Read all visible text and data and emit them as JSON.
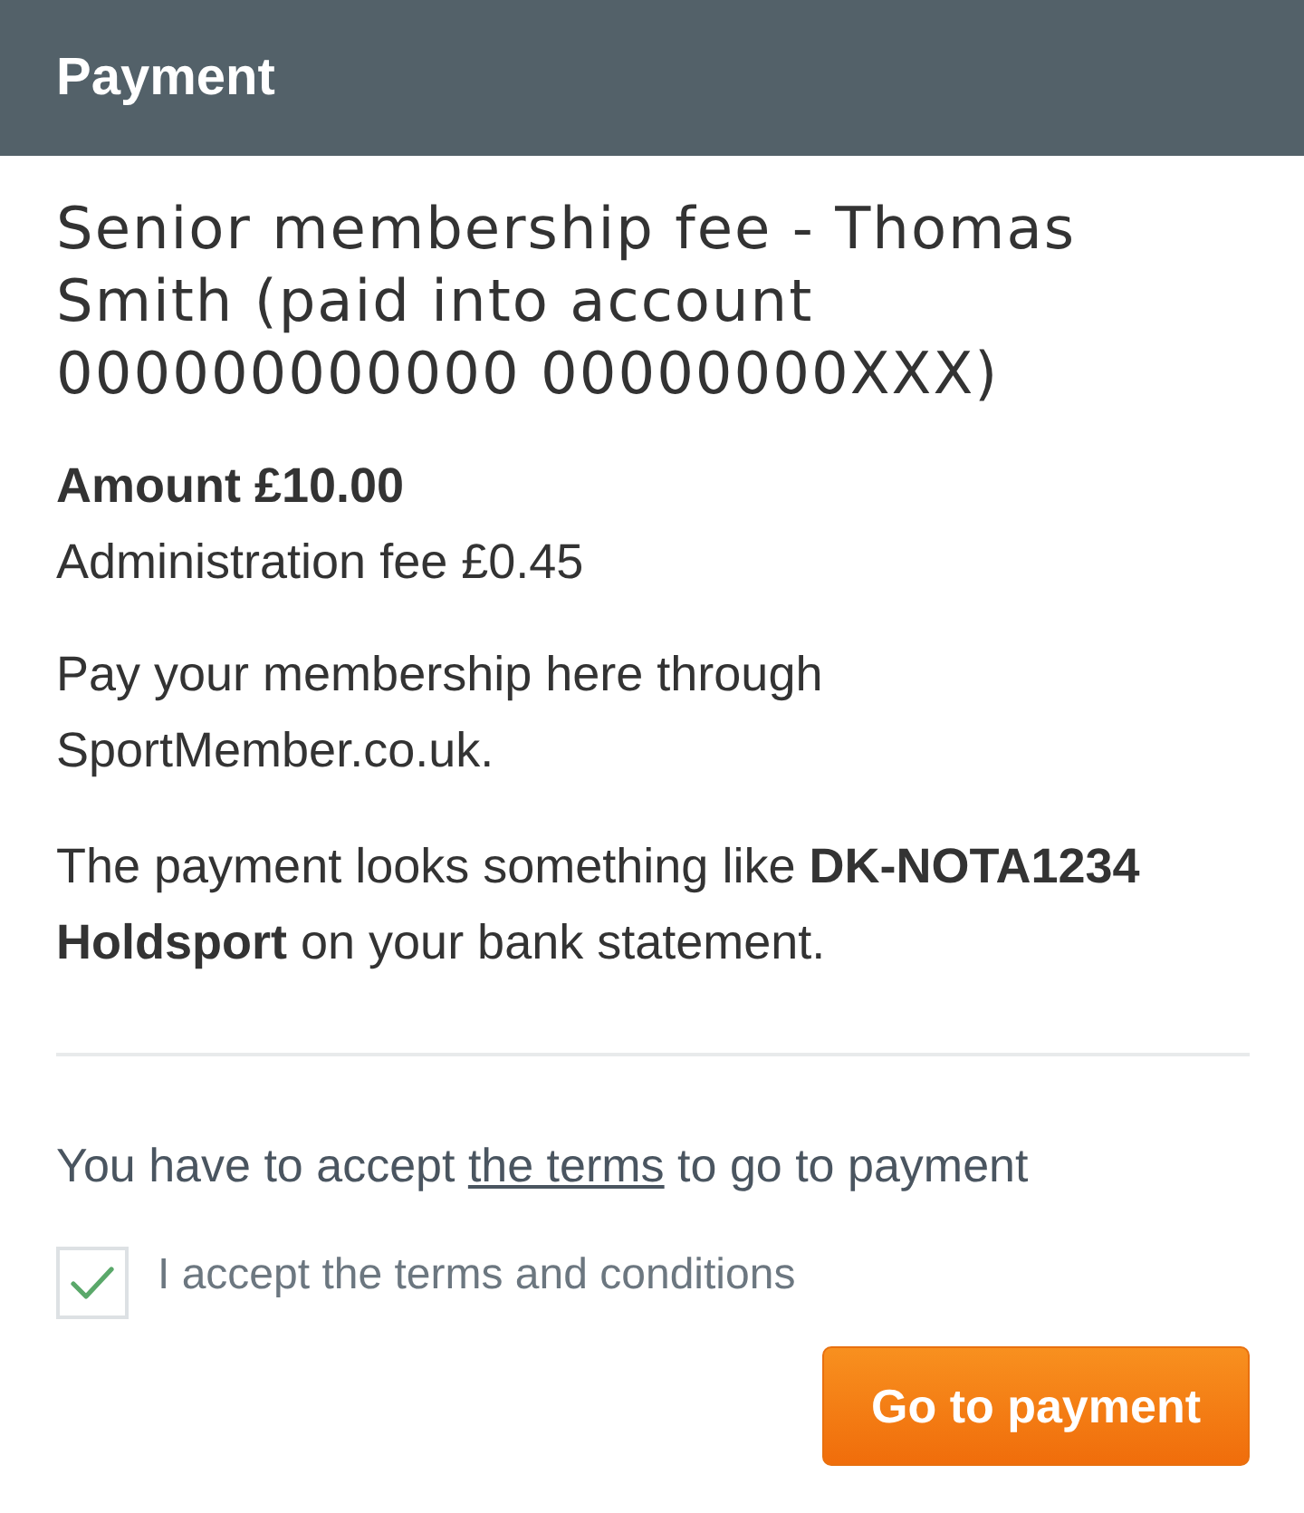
{
  "header": {
    "title": "Payment"
  },
  "description": "Senior membership fee - Thomas Smith (paid into account 000000000000 00000000XXX)",
  "amount": "Amount £10.00",
  "administration_fee": "Administration fee £0.45",
  "paragraphs": [
    "Pay your membership here through SportMember.co.uk.",
    "The payment looks something like **DK-NOTA1234 Holdsport** on your bank statement."
  ],
  "terms_notice": {
    "before": "You have to accept",
    "link": "the terms",
    "after": "to go to payment"
  },
  "accept_checkbox": {
    "label": "I accept the terms and conditions",
    "checked": true
  },
  "pay_button": {
    "label": "Go to payment"
  }
}
